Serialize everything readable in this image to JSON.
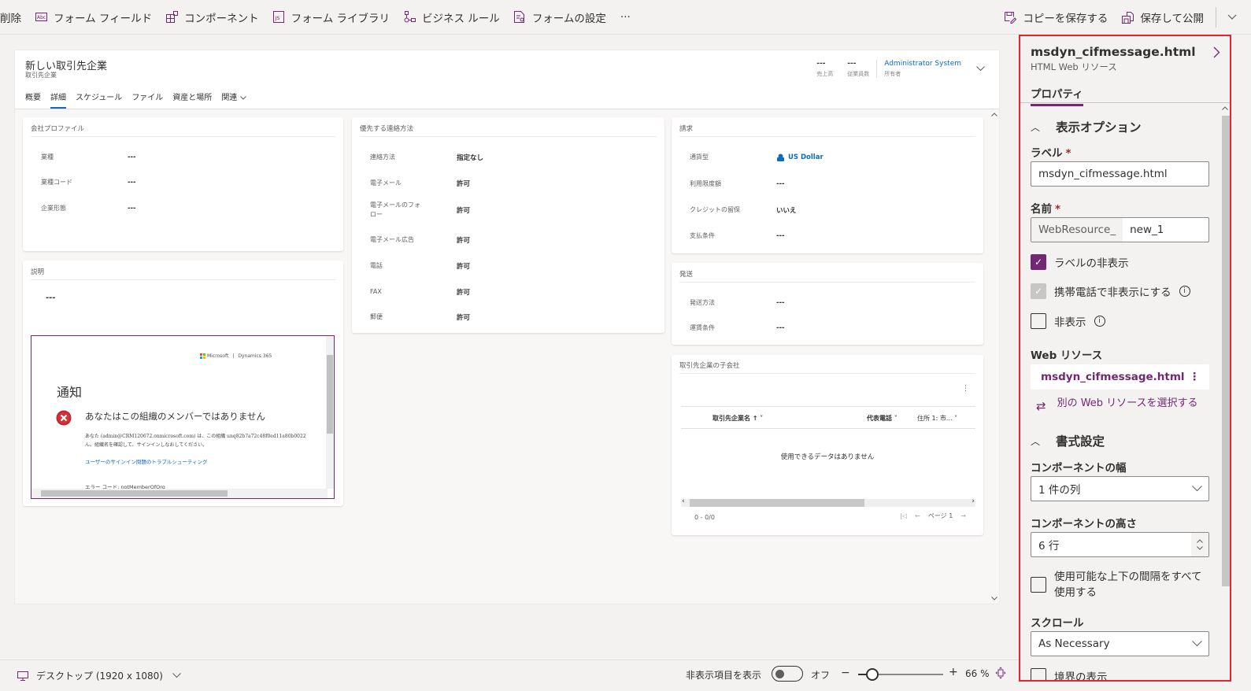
{
  "toolbar": {
    "items": [
      {
        "icon": "delete-icon",
        "label": "削除"
      },
      {
        "icon": "form-field-icon",
        "label": "フォーム フィールド"
      },
      {
        "icon": "component-icon",
        "label": "コンポーネント"
      },
      {
        "icon": "js-library-icon",
        "label": "フォーム ライブラリ"
      },
      {
        "icon": "business-rule-icon",
        "label": "ビジネス ルール"
      },
      {
        "icon": "form-settings-icon",
        "label": "フォームの設定"
      }
    ],
    "more": "···",
    "save_copy": "コピーを保存する",
    "save_publish": "保存して公開"
  },
  "form": {
    "title": "新しい取引先企業",
    "entity": "取引先企業",
    "tabs": [
      "概要",
      "詳細",
      "スケジュール",
      "ファイル",
      "資産と場所",
      "関連"
    ],
    "active_tab": "詳細",
    "header_fields": [
      {
        "value": "---",
        "label": "売上高"
      },
      {
        "value": "---",
        "label": "従業員数"
      },
      {
        "value": "Administrator System",
        "label": "所有者"
      }
    ],
    "company_profile": {
      "title": "会社プロファイル",
      "fields": [
        {
          "label": "業種",
          "value": "---"
        },
        {
          "label": "業種コード",
          "value": "---"
        },
        {
          "label": "企業形態",
          "value": "---"
        }
      ]
    },
    "description": {
      "title": "説明",
      "value": "---"
    },
    "webresource_preview": {
      "brand_ms": "Microsoft",
      "brand_d365": "Dynamics 365",
      "heading": "通知",
      "error_title": "あなたはこの組織のメンバーではありません",
      "error_body_1": "あなた (admin@CRM120672.onmicrosoft.com) は、この組織 unq82b7a72c48f0ed11a80b0022",
      "error_body_2": "ん。組織名を確認して、サインインしなおしてください。",
      "help_link": "ユーザーのサインイン問題のトラブルシューティング",
      "error_code": "エラー コード: notMemberOfOrg"
    },
    "contact_methods": {
      "title": "優先する連絡方法",
      "fields": [
        {
          "label": "連絡方法",
          "value": "指定なし"
        },
        {
          "label": "電子メール",
          "value": "許可"
        },
        {
          "label": "電子メールのフォロー",
          "value": "許可"
        },
        {
          "label": "電子メール広告",
          "value": "許可"
        },
        {
          "label": "電話",
          "value": "許可"
        },
        {
          "label": "FAX",
          "value": "許可"
        },
        {
          "label": "郵便",
          "value": "許可"
        }
      ]
    },
    "billing": {
      "title": "請求",
      "fields": [
        {
          "label": "通貨型",
          "value": "US Dollar"
        },
        {
          "label": "利用限度額",
          "value": "---"
        },
        {
          "label": "クレジットの留保",
          "value": "いいえ"
        },
        {
          "label": "支払条件",
          "value": "---"
        }
      ]
    },
    "shipping": {
      "title": "発送",
      "fields": [
        {
          "label": "発送方法",
          "value": "---"
        },
        {
          "label": "運賃条件",
          "value": "---"
        }
      ]
    },
    "subaccounts": {
      "title": "取引先企業の子会社",
      "columns": [
        "取引先企業名 ↑",
        "代表電話",
        "住所 1: 市..."
      ],
      "empty": "使用できるデータはありません",
      "count": "0 - 0/0",
      "page": "ページ 1"
    }
  },
  "panel": {
    "title": "msdyn_cifmessage.html",
    "subtitle": "HTML Web リソース",
    "tab": "プロパティ",
    "display_section": "表示オプション",
    "label_field": "ラベル",
    "label_value": "msdyn_cifmessage.html",
    "name_field": "名前",
    "name_prefix": "WebResource_",
    "name_value": "new_1",
    "hide_label": "ラベルの非表示",
    "hide_label_checked": true,
    "hide_mobile": "携帯電話で非表示にする",
    "hide_mobile_checked": true,
    "hidden": "非表示",
    "hidden_checked": false,
    "web_resource_label": "Web リソース",
    "web_resource_value": "msdyn_cifmessage.html",
    "choose_other": "別の Web リソースを選択する",
    "format_section": "書式設定",
    "width_label": "コンポーネントの幅",
    "width_value": "1 件の列",
    "height_label": "コンポーネントの高さ",
    "height_value": "6 行",
    "use_all_space": "使用可能な上下の間隔をすべて使用する",
    "scroll_label": "スクロール",
    "scroll_value": "As Necessary",
    "show_border": "境界の表示"
  },
  "status": {
    "device": "デスクトップ (1920 x 1080)",
    "show_hidden": "非表示項目を表示",
    "toggle_state": "オフ",
    "zoom_minus": "−",
    "zoom_plus": "+",
    "zoom": "66 %",
    "zoom_percent": 66
  },
  "colors": {
    "accent": "#742774",
    "link": "#0f6cbd",
    "highlight": "#e8232f"
  }
}
